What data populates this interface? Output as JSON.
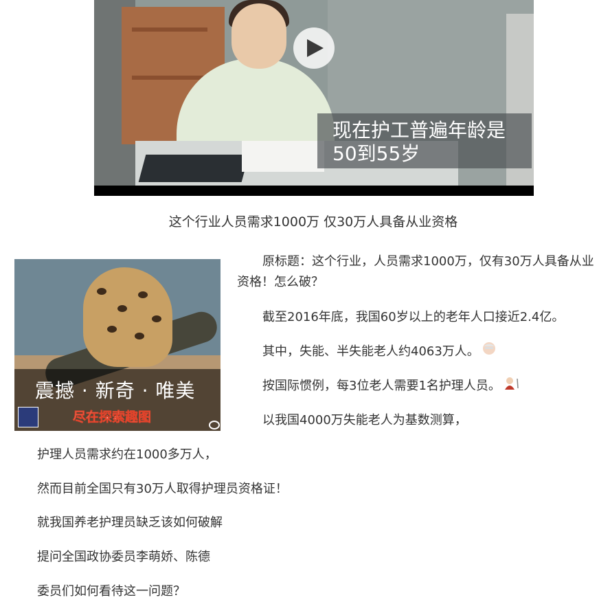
{
  "video": {
    "caption_line1": "现在护工普遍年龄是",
    "caption_line2": "50到55岁"
  },
  "headline": "这个行业人员需求1000万 仅30万人具备从业资格",
  "ad": {
    "title": "震撼 · 新奇 · 唯美",
    "subtitle": "尽在探索趣图"
  },
  "article": {
    "p1_line1": "原标题：这个行业，人员需求1000万，仅有30万人具备从业",
    "p1_line2": "资格！怎么破？",
    "p2": "截至2016年底，我国60岁以上的老年人口接近2.4亿。",
    "p3": "其中，失能、半失能老人约4063万人。",
    "p4": "按国际惯例，每3位老人需要1名护理人员。",
    "p5": "以我国4000万失能老人为基数测算，",
    "p6": "护理人员需求约在1000多万人，",
    "p7": "然而目前全国只有30万人取得护理员资格证！",
    "p8": "就我国养老护理员缺乏该如何破解",
    "p9": "提问全国政协委员李萌娇、陈德",
    "p10": "委员们如何看待这一问题？"
  },
  "icons": {
    "play": "play-icon",
    "elder_face": "elderly-face-emoji",
    "elder_woman": "elderly-woman-emoji"
  }
}
